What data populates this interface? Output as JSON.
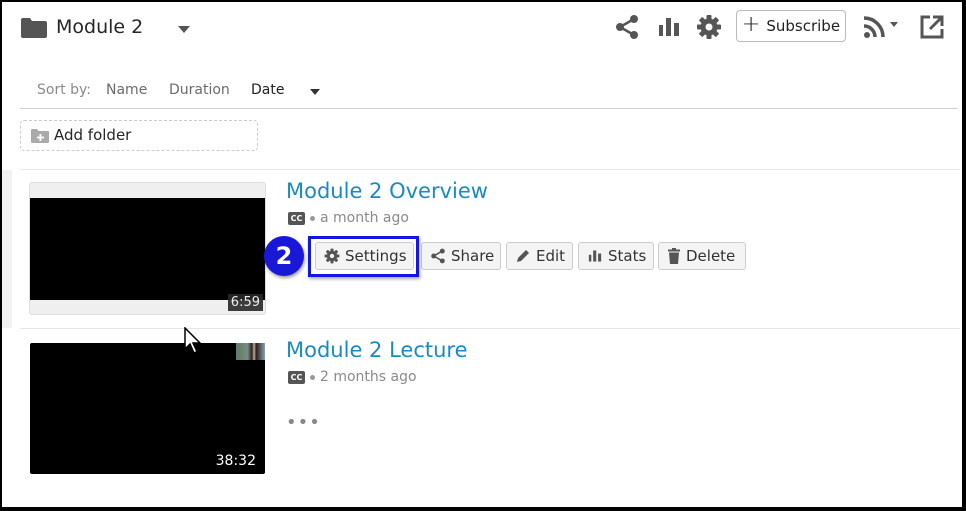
{
  "header": {
    "folder_icon": "folder-icon",
    "title": "Module 2",
    "actions": {
      "share_icon": "share-icon",
      "stats_icon": "bar-chart-icon",
      "settings_icon": "gear-icon",
      "subscribe_label": "Subscribe",
      "rss_icon": "rss-icon",
      "external_icon": "external-link-icon"
    }
  },
  "sort": {
    "label": "Sort by:",
    "options": [
      "Name",
      "Duration",
      "Date"
    ],
    "active": "Date"
  },
  "add_folder_label": "Add folder",
  "videos": [
    {
      "title": "Module 2 Overview",
      "captions": "CC",
      "age": "a month ago",
      "duration": "6:59",
      "actions": [
        "Settings",
        "Share",
        "Edit",
        "Stats",
        "Delete"
      ]
    },
    {
      "title": "Module 2 Lecture",
      "captions": "CC",
      "age": "2 months ago",
      "duration": "38:32",
      "more_label": "•••"
    }
  ],
  "annotation": {
    "step_number": "2",
    "highlight_color": "#1414e6",
    "badge_color": "#1818d6"
  },
  "colors": {
    "link": "#1a8ac6",
    "icon": "#555555"
  }
}
